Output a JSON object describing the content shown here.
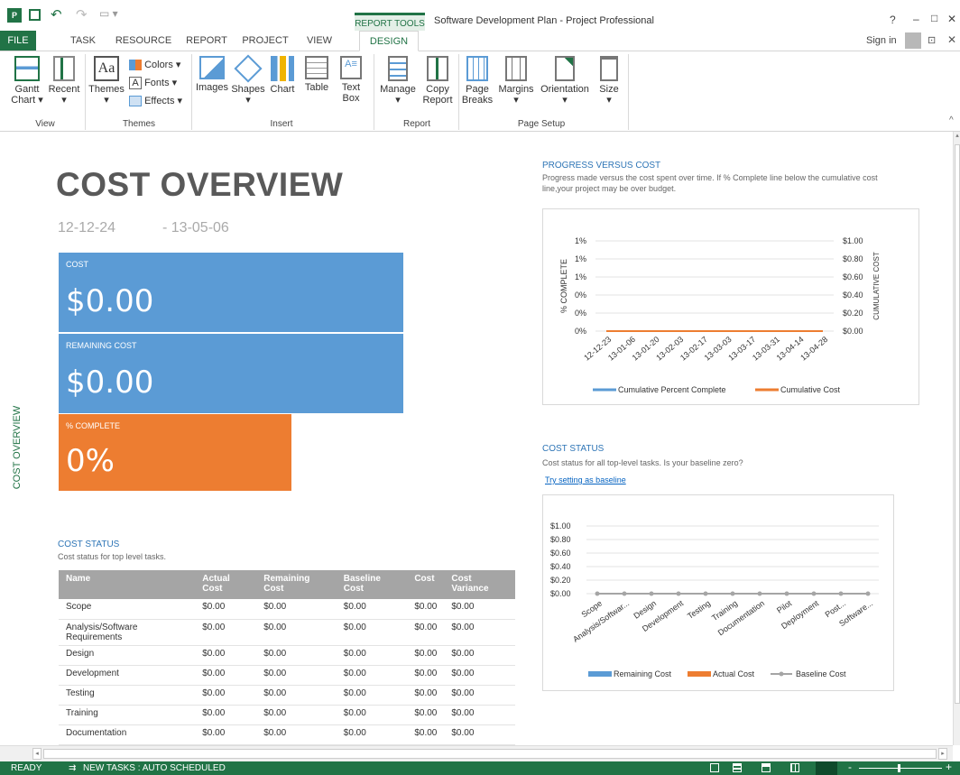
{
  "title_bar": {
    "report_tools": "REPORT TOOLS",
    "window_title": "Software Development Plan - Project Professional",
    "help": "?",
    "minimize": "–",
    "maximize": "□",
    "close": "✕"
  },
  "tabs": [
    "FILE",
    "TASK",
    "RESOURCE",
    "REPORT",
    "PROJECT",
    "VIEW",
    "DESIGN"
  ],
  "sign_in": "Sign in",
  "ribbon": {
    "gantt": "Gantt",
    "gantt2": "Chart",
    "recent": "Recent",
    "themes": "Themes",
    "colors": "Colors",
    "fonts": "Fonts",
    "effects": "Effects",
    "images": "Images",
    "shapes": "Shapes",
    "chart": "Chart",
    "table": "Table",
    "text": "Text",
    "box": "Box",
    "manage": "Manage",
    "copy": "Copy",
    "report": "Report",
    "page": "Page",
    "breaks": "Breaks",
    "margins": "Margins",
    "orientation": "Orientation",
    "size": "Size",
    "groups": {
      "view": "View",
      "themes": "Themes",
      "insert": "Insert",
      "report": "Report",
      "page_setup": "Page Setup"
    }
  },
  "report": {
    "side_label": "COST OVERVIEW",
    "title": "COST OVERVIEW",
    "start_date": "12-12-24",
    "end_date": "- 13-05-06",
    "tiles": {
      "cost_label": "COST",
      "cost_value": "$0.00",
      "remaining_label": "REMAINING COST",
      "remaining_value": "$0.00",
      "complete_label": "% COMPLETE",
      "complete_value": "0%"
    },
    "cost_status": {
      "heading": "COST STATUS",
      "subtitle": "Cost status for top level tasks.",
      "columns": [
        "Name",
        "Actual Cost",
        "Remaining Cost",
        "Baseline Cost",
        "Cost",
        "Cost Variance"
      ],
      "rows": [
        [
          "Scope",
          "$0.00",
          "$0.00",
          "$0.00",
          "$0.00",
          "$0.00"
        ],
        [
          "Analysis/Software Requirements",
          "$0.00",
          "$0.00",
          "$0.00",
          "$0.00",
          "$0.00"
        ],
        [
          "Design",
          "$0.00",
          "$0.00",
          "$0.00",
          "$0.00",
          "$0.00"
        ],
        [
          "Development",
          "$0.00",
          "$0.00",
          "$0.00",
          "$0.00",
          "$0.00"
        ],
        [
          "Testing",
          "$0.00",
          "$0.00",
          "$0.00",
          "$0.00",
          "$0.00"
        ],
        [
          "Training",
          "$0.00",
          "$0.00",
          "$0.00",
          "$0.00",
          "$0.00"
        ],
        [
          "Documentation",
          "$0.00",
          "$0.00",
          "$0.00",
          "$0.00",
          "$0.00"
        ]
      ]
    },
    "progress": {
      "heading": "PROGRESS VERSUS COST",
      "desc1": "Progress made versus the cost spent over time. If % Complete line below the cumulative cost",
      "desc2": "line,your project may be over budget."
    },
    "cost_status_chart": {
      "heading": "COST STATUS",
      "desc": "Cost status for all top-level tasks. Is your baseline zero?",
      "link": "Try setting as baseline"
    }
  },
  "chart_data": [
    {
      "type": "line",
      "x": [
        "12-12-23",
        "13-01-06",
        "13-01-20",
        "13-02-03",
        "13-02-17",
        "13-03-03",
        "13-03-17",
        "13-03-31",
        "13-04-14",
        "13-04-28"
      ],
      "ylabel": "% COMPLETE",
      "y2label": "CUMULATIVE COST",
      "y_ticks": [
        "1%",
        "1%",
        "1%",
        "0%",
        "0%",
        "0%"
      ],
      "y2_ticks": [
        "$1.00",
        "$0.80",
        "$0.60",
        "$0.40",
        "$0.20",
        "$0.00"
      ],
      "series": [
        {
          "name": "Cumulative Percent Complete",
          "values": [
            0,
            0,
            0,
            0,
            0,
            0,
            0,
            0,
            0,
            0
          ],
          "color": "#5b9bd5"
        },
        {
          "name": "Cumulative Cost",
          "values": [
            0,
            0,
            0,
            0,
            0,
            0,
            0,
            0,
            0,
            0
          ],
          "color": "#ed7d31"
        }
      ]
    },
    {
      "type": "bar",
      "categories": [
        "Scope",
        "Analysis/Softwar...",
        "Design",
        "Development",
        "Testing",
        "Training",
        "Documentation",
        "Pilot",
        "Deployment",
        "Post...",
        "Software..."
      ],
      "y_ticks": [
        "$1.00",
        "$0.80",
        "$0.60",
        "$0.40",
        "$0.20",
        "$0.00"
      ],
      "series": [
        {
          "name": "Remaining Cost",
          "values": [
            0,
            0,
            0,
            0,
            0,
            0,
            0,
            0,
            0,
            0,
            0
          ],
          "color": "#5b9bd5"
        },
        {
          "name": "Actual Cost",
          "values": [
            0,
            0,
            0,
            0,
            0,
            0,
            0,
            0,
            0,
            0,
            0
          ],
          "color": "#ed7d31"
        },
        {
          "name": "Baseline Cost",
          "values": [
            0,
            0,
            0,
            0,
            0,
            0,
            0,
            0,
            0,
            0,
            0
          ],
          "color": "#a5a5a5"
        }
      ]
    }
  ],
  "status_bar": {
    "ready": "READY",
    "new_tasks": "NEW TASKS : AUTO SCHEDULED"
  },
  "colors": {
    "accent": "#217346",
    "blue": "#5b9bd5",
    "orange": "#ed7d31",
    "gray": "#a5a5a5"
  }
}
